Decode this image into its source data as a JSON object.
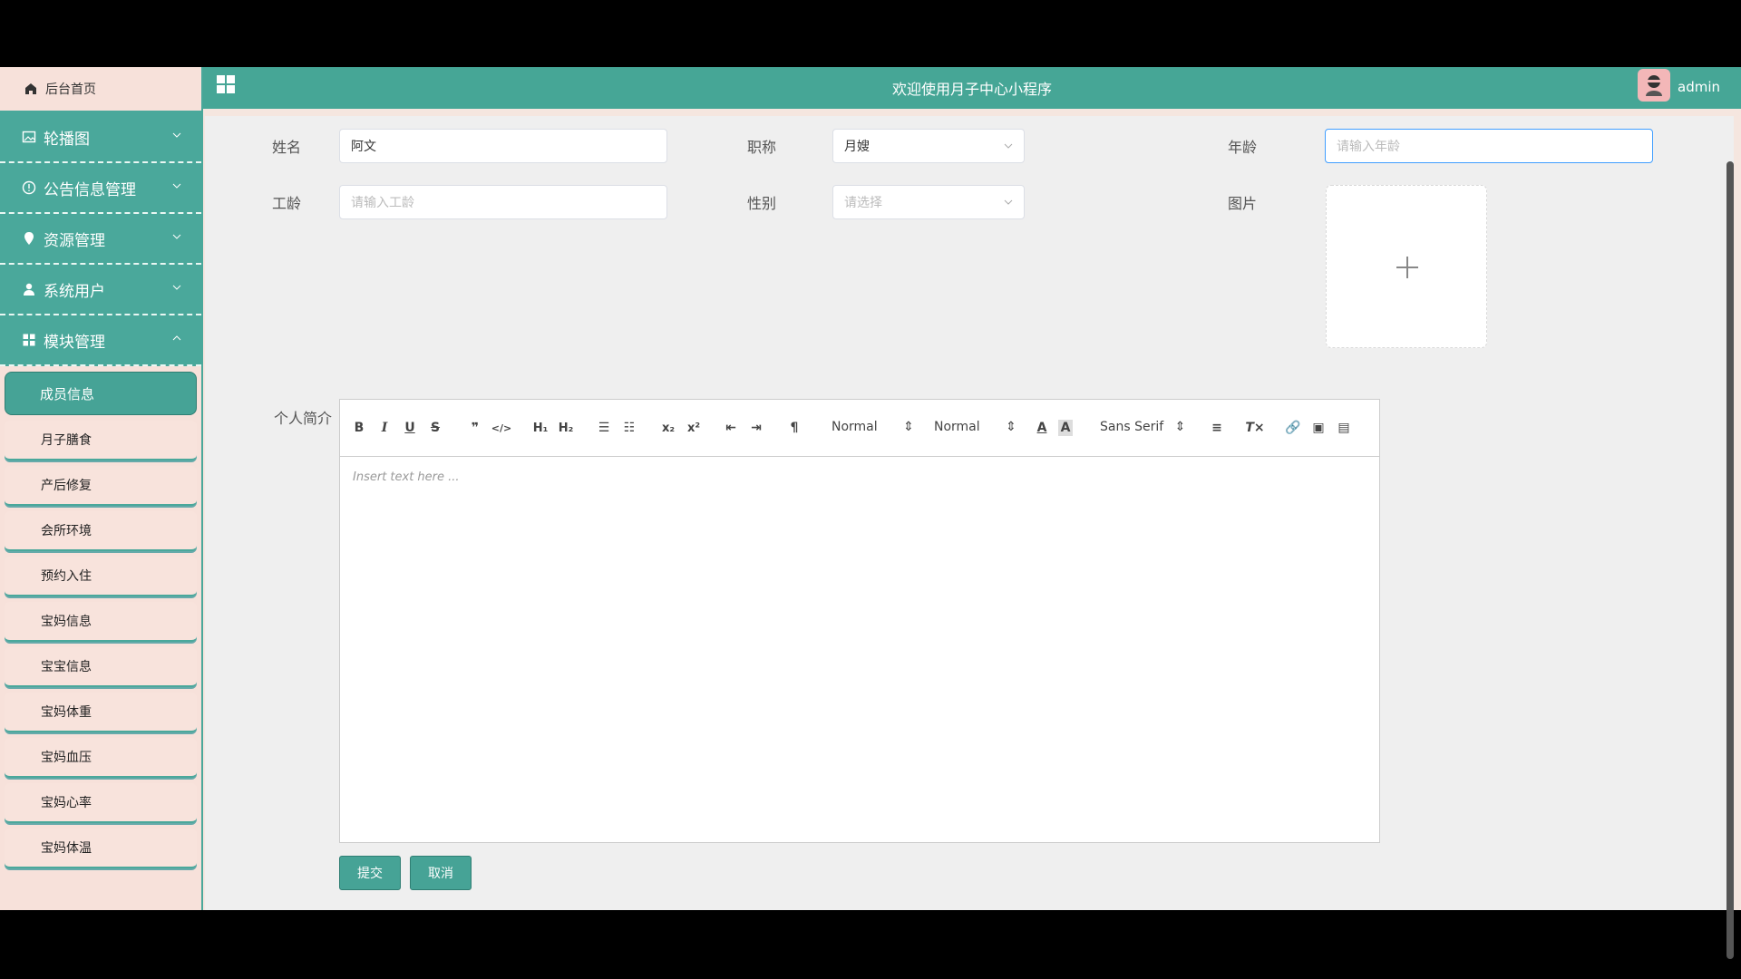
{
  "app": {
    "title": "欢迎使用月子中心小程序",
    "user": "admin"
  },
  "sidebar": {
    "home": "后台首页",
    "menus": [
      {
        "label": "轮播图",
        "icon": "image-icon"
      },
      {
        "label": "公告信息管理",
        "icon": "info-circle-icon"
      },
      {
        "label": "资源管理",
        "icon": "location-icon"
      },
      {
        "label": "系统用户",
        "icon": "user-icon"
      },
      {
        "label": "模块管理",
        "icon": "grid-icon"
      }
    ],
    "active_item": "成员信息",
    "items": [
      "月子膳食",
      "产后修复",
      "会所环境",
      "预约入住",
      "宝妈信息",
      "宝宝信息",
      "宝妈体重",
      "宝妈血压",
      "宝妈心率",
      "宝妈体温"
    ]
  },
  "form": {
    "name": {
      "label": "姓名",
      "value": "阿文"
    },
    "title": {
      "label": "职称",
      "value": "月嫂"
    },
    "age": {
      "label": "年龄",
      "placeholder": "请输入年龄"
    },
    "work_years": {
      "label": "工龄",
      "placeholder": "请输入工龄"
    },
    "gender": {
      "label": "性别",
      "placeholder": "请选择"
    },
    "picture": {
      "label": "图片"
    },
    "intro": {
      "label": "个人简介",
      "placeholder": "Insert text here ..."
    }
  },
  "editor_toolbar": {
    "header_select": "Normal",
    "size_select": "Normal",
    "font_select": "Sans Serif"
  },
  "buttons": {
    "submit": "提交",
    "cancel": "取消"
  },
  "colors": {
    "primary": "#46a396",
    "sidebar_bg": "#f7e1da",
    "focus": "#409eff"
  }
}
